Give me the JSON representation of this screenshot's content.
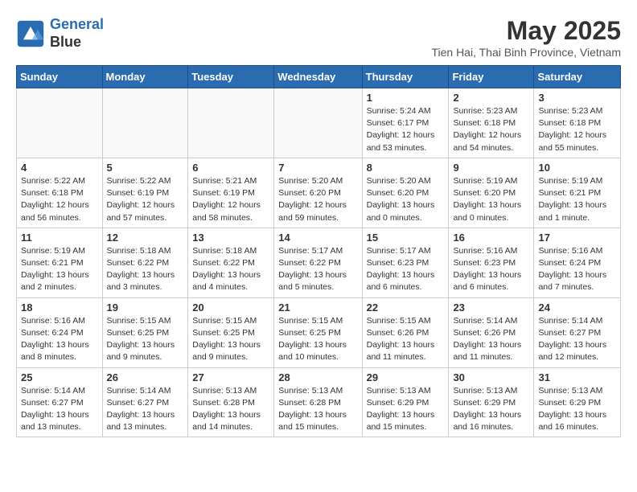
{
  "header": {
    "logo_line1": "General",
    "logo_line2": "Blue",
    "month_title": "May 2025",
    "location": "Tien Hai, Thai Binh Province, Vietnam"
  },
  "weekdays": [
    "Sunday",
    "Monday",
    "Tuesday",
    "Wednesday",
    "Thursday",
    "Friday",
    "Saturday"
  ],
  "weeks": [
    [
      {
        "day": "",
        "info": ""
      },
      {
        "day": "",
        "info": ""
      },
      {
        "day": "",
        "info": ""
      },
      {
        "day": "",
        "info": ""
      },
      {
        "day": "1",
        "info": "Sunrise: 5:24 AM\nSunset: 6:17 PM\nDaylight: 12 hours\nand 53 minutes."
      },
      {
        "day": "2",
        "info": "Sunrise: 5:23 AM\nSunset: 6:18 PM\nDaylight: 12 hours\nand 54 minutes."
      },
      {
        "day": "3",
        "info": "Sunrise: 5:23 AM\nSunset: 6:18 PM\nDaylight: 12 hours\nand 55 minutes."
      }
    ],
    [
      {
        "day": "4",
        "info": "Sunrise: 5:22 AM\nSunset: 6:18 PM\nDaylight: 12 hours\nand 56 minutes."
      },
      {
        "day": "5",
        "info": "Sunrise: 5:22 AM\nSunset: 6:19 PM\nDaylight: 12 hours\nand 57 minutes."
      },
      {
        "day": "6",
        "info": "Sunrise: 5:21 AM\nSunset: 6:19 PM\nDaylight: 12 hours\nand 58 minutes."
      },
      {
        "day": "7",
        "info": "Sunrise: 5:20 AM\nSunset: 6:20 PM\nDaylight: 12 hours\nand 59 minutes."
      },
      {
        "day": "8",
        "info": "Sunrise: 5:20 AM\nSunset: 6:20 PM\nDaylight: 13 hours\nand 0 minutes."
      },
      {
        "day": "9",
        "info": "Sunrise: 5:19 AM\nSunset: 6:20 PM\nDaylight: 13 hours\nand 0 minutes."
      },
      {
        "day": "10",
        "info": "Sunrise: 5:19 AM\nSunset: 6:21 PM\nDaylight: 13 hours\nand 1 minute."
      }
    ],
    [
      {
        "day": "11",
        "info": "Sunrise: 5:19 AM\nSunset: 6:21 PM\nDaylight: 13 hours\nand 2 minutes."
      },
      {
        "day": "12",
        "info": "Sunrise: 5:18 AM\nSunset: 6:22 PM\nDaylight: 13 hours\nand 3 minutes."
      },
      {
        "day": "13",
        "info": "Sunrise: 5:18 AM\nSunset: 6:22 PM\nDaylight: 13 hours\nand 4 minutes."
      },
      {
        "day": "14",
        "info": "Sunrise: 5:17 AM\nSunset: 6:22 PM\nDaylight: 13 hours\nand 5 minutes."
      },
      {
        "day": "15",
        "info": "Sunrise: 5:17 AM\nSunset: 6:23 PM\nDaylight: 13 hours\nand 6 minutes."
      },
      {
        "day": "16",
        "info": "Sunrise: 5:16 AM\nSunset: 6:23 PM\nDaylight: 13 hours\nand 6 minutes."
      },
      {
        "day": "17",
        "info": "Sunrise: 5:16 AM\nSunset: 6:24 PM\nDaylight: 13 hours\nand 7 minutes."
      }
    ],
    [
      {
        "day": "18",
        "info": "Sunrise: 5:16 AM\nSunset: 6:24 PM\nDaylight: 13 hours\nand 8 minutes."
      },
      {
        "day": "19",
        "info": "Sunrise: 5:15 AM\nSunset: 6:25 PM\nDaylight: 13 hours\nand 9 minutes."
      },
      {
        "day": "20",
        "info": "Sunrise: 5:15 AM\nSunset: 6:25 PM\nDaylight: 13 hours\nand 9 minutes."
      },
      {
        "day": "21",
        "info": "Sunrise: 5:15 AM\nSunset: 6:25 PM\nDaylight: 13 hours\nand 10 minutes."
      },
      {
        "day": "22",
        "info": "Sunrise: 5:15 AM\nSunset: 6:26 PM\nDaylight: 13 hours\nand 11 minutes."
      },
      {
        "day": "23",
        "info": "Sunrise: 5:14 AM\nSunset: 6:26 PM\nDaylight: 13 hours\nand 11 minutes."
      },
      {
        "day": "24",
        "info": "Sunrise: 5:14 AM\nSunset: 6:27 PM\nDaylight: 13 hours\nand 12 minutes."
      }
    ],
    [
      {
        "day": "25",
        "info": "Sunrise: 5:14 AM\nSunset: 6:27 PM\nDaylight: 13 hours\nand 13 minutes."
      },
      {
        "day": "26",
        "info": "Sunrise: 5:14 AM\nSunset: 6:27 PM\nDaylight: 13 hours\nand 13 minutes."
      },
      {
        "day": "27",
        "info": "Sunrise: 5:13 AM\nSunset: 6:28 PM\nDaylight: 13 hours\nand 14 minutes."
      },
      {
        "day": "28",
        "info": "Sunrise: 5:13 AM\nSunset: 6:28 PM\nDaylight: 13 hours\nand 15 minutes."
      },
      {
        "day": "29",
        "info": "Sunrise: 5:13 AM\nSunset: 6:29 PM\nDaylight: 13 hours\nand 15 minutes."
      },
      {
        "day": "30",
        "info": "Sunrise: 5:13 AM\nSunset: 6:29 PM\nDaylight: 13 hours\nand 16 minutes."
      },
      {
        "day": "31",
        "info": "Sunrise: 5:13 AM\nSunset: 6:29 PM\nDaylight: 13 hours\nand 16 minutes."
      }
    ]
  ]
}
